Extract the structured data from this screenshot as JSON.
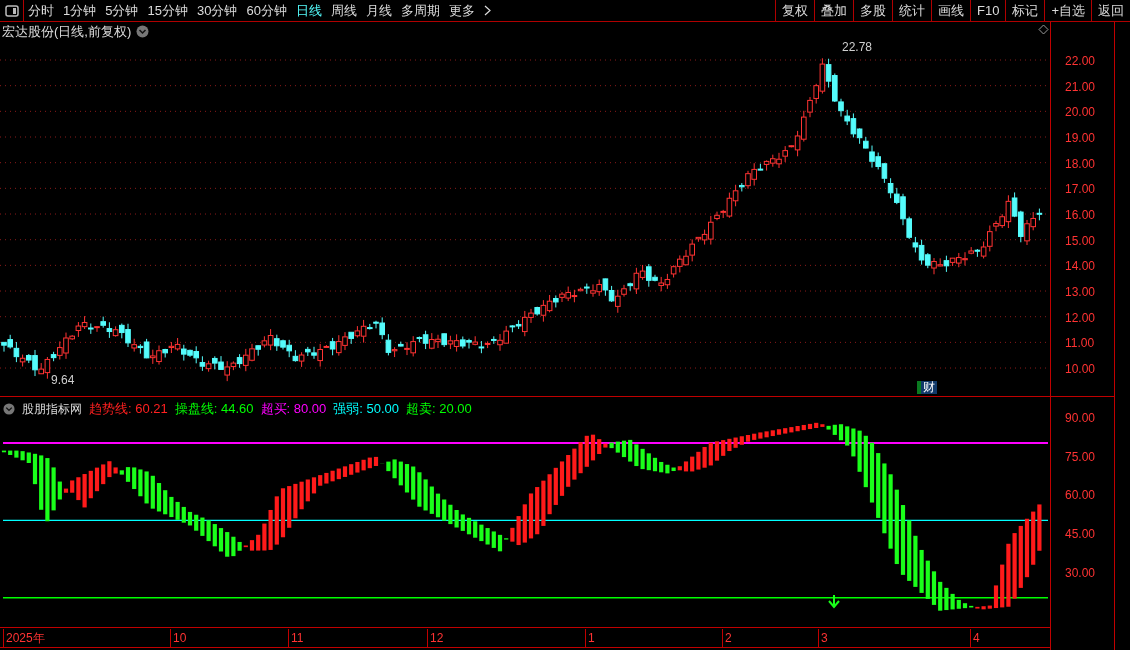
{
  "toolbar": {
    "periods": [
      {
        "label": "分时",
        "selected": false
      },
      {
        "label": "1分钟",
        "selected": false
      },
      {
        "label": "5分钟",
        "selected": false
      },
      {
        "label": "15分钟",
        "selected": false
      },
      {
        "label": "30分钟",
        "selected": false
      },
      {
        "label": "60分钟",
        "selected": false
      },
      {
        "label": "日线",
        "selected": true
      },
      {
        "label": "周线",
        "selected": false
      },
      {
        "label": "月线",
        "selected": false
      },
      {
        "label": "多周期",
        "selected": false
      },
      {
        "label": "更多",
        "selected": false
      }
    ],
    "actions": [
      "复权",
      "叠加",
      "多股",
      "统计",
      "画线",
      "F10",
      "标记",
      "+自选",
      "返回"
    ]
  },
  "price_panel": {
    "title": "宏达股份(日线,前复权)",
    "high_label": "22.78",
    "low_label": "9.64",
    "badge": "财",
    "y_ticks": [
      "22.00",
      "21.00",
      "20.00",
      "19.00",
      "18.00",
      "17.00",
      "16.00",
      "15.00",
      "14.00",
      "13.00",
      "12.00",
      "11.00",
      "10.00"
    ]
  },
  "indicator_panel": {
    "title": "股朋指标网",
    "legend": [
      {
        "label": "趋势线: 60.21",
        "color": "#ff2020"
      },
      {
        "label": "操盘线: 44.60",
        "color": "#00ff00"
      },
      {
        "label": "超买: 80.00",
        "color": "#ff00ff"
      },
      {
        "label": "强弱: 50.00",
        "color": "#00ffff"
      },
      {
        "label": "超卖: 20.00",
        "color": "#00ff00"
      }
    ],
    "y_ticks": [
      "90.00",
      "75.00",
      "60.00",
      "45.00",
      "30.00"
    ]
  },
  "time_axis": {
    "labels": [
      "2025年",
      "10",
      "11",
      "12",
      "1",
      "2",
      "3",
      "4"
    ]
  }
}
